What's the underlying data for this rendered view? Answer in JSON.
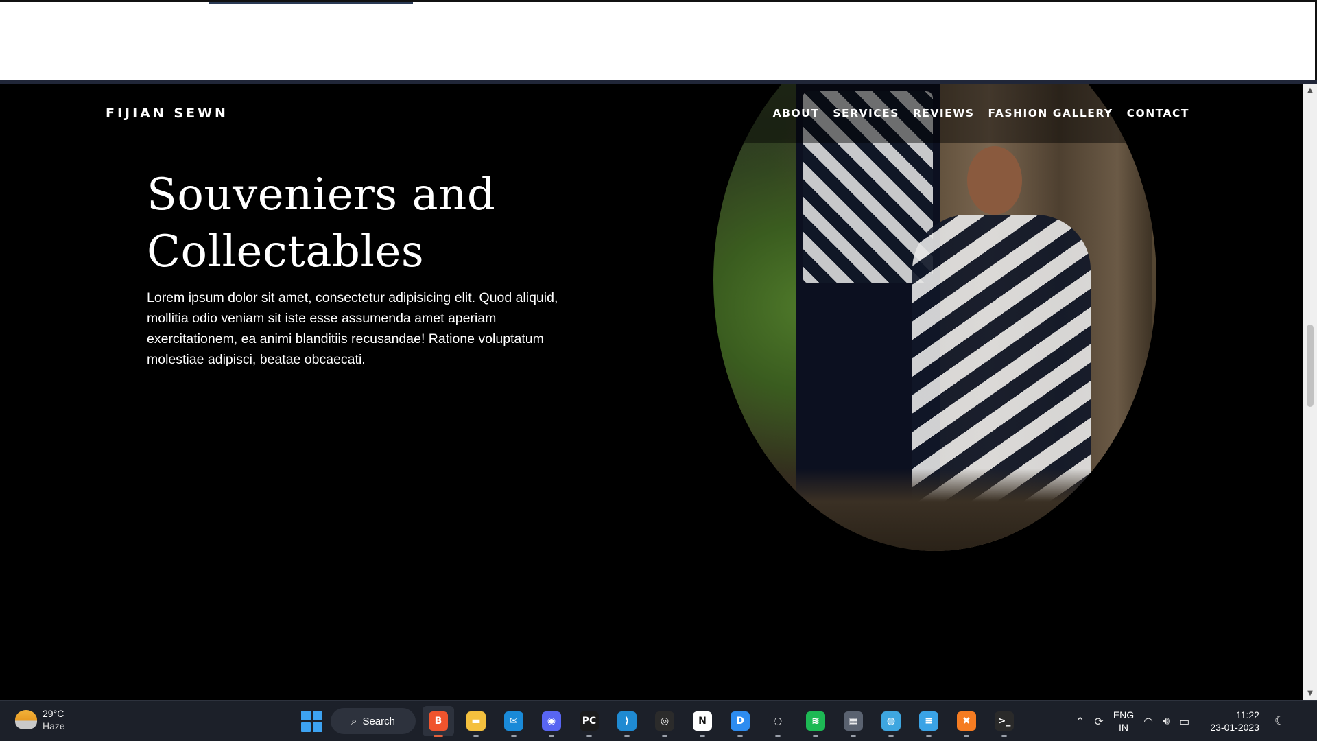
{
  "site": {
    "brand": "FIJIAN SEWN",
    "nav": [
      "ABOUT",
      "SERVICES",
      "REVIEWS",
      "FASHION GALLERY",
      "CONTACT"
    ],
    "hero": {
      "title_line1": "Souveniers and",
      "title_line2": "Collectables",
      "body": "Lorem ipsum dolor sit amet, consectetur adipisicing elit. Quod aliquid, mollitia odio veniam sit iste esse assumenda amet aperiam exercitationem, ea animi blanditiis recusandae! Ratione voluptatum molestiae adipisci, beatae obcaecati."
    }
  },
  "taskbar": {
    "weather": {
      "temp": "29°C",
      "condition": "Haze",
      "icon": "haze-sun-icon"
    },
    "search_label": "Search",
    "apps": [
      {
        "name": "brave",
        "icon": "brave-icon",
        "color": "#f0542d",
        "glyph": "B",
        "active": true
      },
      {
        "name": "file-explorer",
        "icon": "folder-icon",
        "color": "#f4c03e",
        "glyph": "▬",
        "active": false
      },
      {
        "name": "mail",
        "icon": "mail-icon",
        "color": "#1a8ad8",
        "glyph": "✉",
        "active": false
      },
      {
        "name": "discord",
        "icon": "discord-icon",
        "color": "#5865f2",
        "glyph": "◉",
        "active": false
      },
      {
        "name": "pycharm",
        "icon": "pycharm-icon",
        "color": "#1c1c1c",
        "glyph": "PC",
        "active": false
      },
      {
        "name": "vscode",
        "icon": "vscode-icon",
        "color": "#1f8ad2",
        "glyph": "⟩",
        "active": false
      },
      {
        "name": "obs",
        "icon": "obs-icon",
        "color": "#2b2b2b",
        "glyph": "◎",
        "active": false
      },
      {
        "name": "notion",
        "icon": "notion-icon",
        "color": "#ffffff",
        "glyph": "N",
        "active": false
      },
      {
        "name": "app-blue",
        "icon": "document-app-icon",
        "color": "#2d8cf0",
        "glyph": "D",
        "active": false
      },
      {
        "name": "app-green-ring",
        "icon": "green-ring-icon",
        "color": "#1c2029",
        "glyph": "◌",
        "active": false
      },
      {
        "name": "spotify",
        "icon": "spotify-icon",
        "color": "#1db954",
        "glyph": "≋",
        "active": false
      },
      {
        "name": "calculator",
        "icon": "calculator-icon",
        "color": "#5a6270",
        "glyph": "▦",
        "active": false
      },
      {
        "name": "globe-app",
        "icon": "globe-icon",
        "color": "#3ea6e0",
        "glyph": "◍",
        "active": false
      },
      {
        "name": "notepad",
        "icon": "notepad-icon",
        "color": "#3aa3e6",
        "glyph": "≡",
        "active": false
      },
      {
        "name": "xampp",
        "icon": "xampp-icon",
        "color": "#f57c22",
        "glyph": "✖",
        "active": false
      },
      {
        "name": "terminal",
        "icon": "terminal-icon",
        "color": "#2a2a2a",
        "glyph": ">_",
        "active": false
      }
    ],
    "tray": {
      "lang_line1": "ENG",
      "lang_line2": "IN",
      "time": "11:22",
      "date": "23-01-2023"
    }
  }
}
